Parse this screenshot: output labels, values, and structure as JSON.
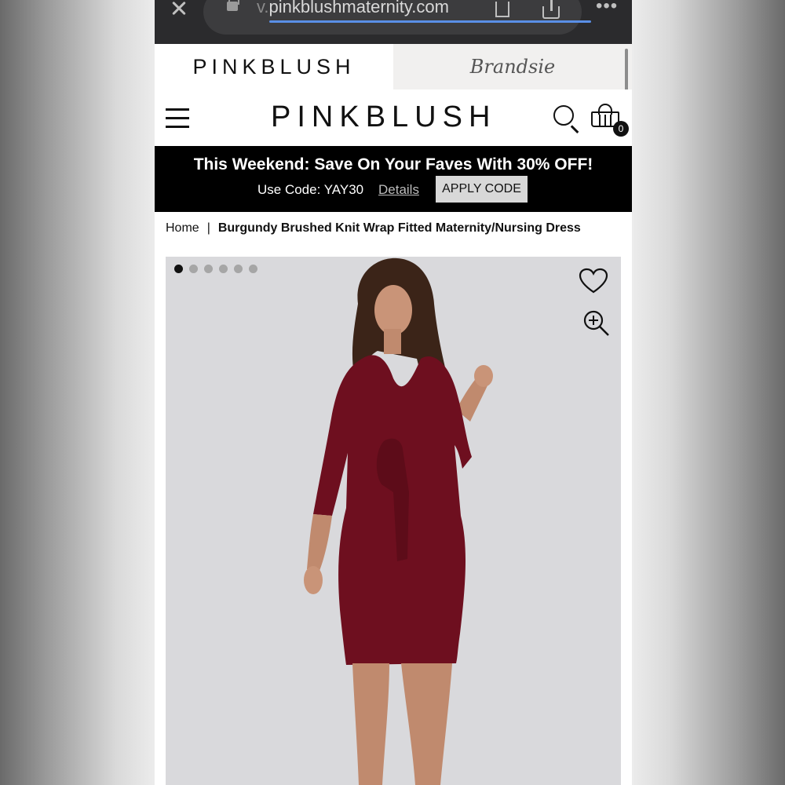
{
  "browser": {
    "url_prefix": "v.",
    "url_domain": "pinkblushmaternity.com"
  },
  "brand_tabs": {
    "left": "PINKBLUSH",
    "right": "Brandsie"
  },
  "header": {
    "logo": "PINKBLUSH",
    "cart_count": "0"
  },
  "promo": {
    "headline": "This Weekend: Save On Your Faves With 30% OFF!",
    "code_text": "Use Code: YAY30",
    "details_link": "Details",
    "apply_button": "APPLY CODE"
  },
  "breadcrumb": {
    "home": "Home",
    "separator": "|",
    "current": "Burgundy Brushed Knit Wrap Fitted Maternity/Nursing Dress"
  },
  "gallery": {
    "image_count": 6,
    "active_index": 0
  },
  "colors": {
    "dress": "#6e0f1f",
    "promo_bg": "#000000",
    "image_bg": "#d9d9dc"
  }
}
